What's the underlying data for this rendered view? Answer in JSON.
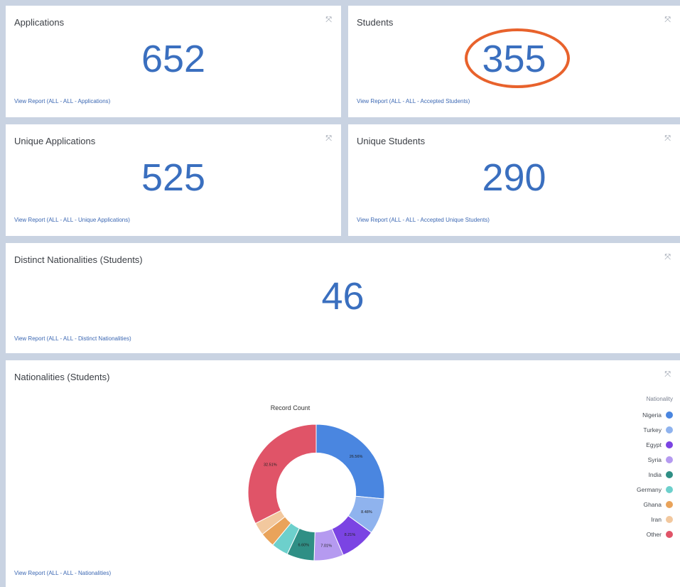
{
  "cards": {
    "applications": {
      "title": "Applications",
      "value": "652",
      "link": "View Report (ALL - ALL - Applications)"
    },
    "students": {
      "title": "Students",
      "value": "355",
      "link": "View Report (ALL - ALL - Accepted Students)"
    },
    "unique_applications": {
      "title": "Unique Applications",
      "value": "525",
      "link": "View Report (ALL - ALL - Unique Applications)"
    },
    "unique_students": {
      "title": "Unique Students",
      "value": "290",
      "link": "View Report (ALL - ALL - Accepted Unique Students)"
    },
    "distinct_nationalities": {
      "title": "Distinct Nationalities (Students)",
      "value": "46",
      "link": "View Report (ALL - ALL - Distinct Nationalities)"
    },
    "nationalities": {
      "title": "Nationalities (Students)",
      "link": "View Report (ALL - ALL - Nationalities)"
    }
  },
  "expand_icon": "⤧",
  "annotation_color": "#e8622c",
  "chart_data": {
    "type": "pie",
    "title": "Record Count",
    "legend_title": "Nationality",
    "legend_position": "right",
    "categories": [
      "Nigeria",
      "Turkey",
      "Egypt",
      "Syria",
      "India",
      "Germany",
      "Ghana",
      "Iran",
      "Other"
    ],
    "values": [
      26.5,
      8.5,
      8.5,
      7.0,
      6.5,
      4.0,
      3.5,
      3.0,
      32.5
    ],
    "slice_labels": [
      "26.56%",
      "8.48%",
      "8.21%",
      "7.01%",
      "6.60%",
      "",
      "",
      "",
      "32.51%"
    ],
    "colors": [
      "#4a86e0",
      "#8fb3ee",
      "#7b44e3",
      "#b59af0",
      "#2f8f85",
      "#6dd0cc",
      "#e9a35a",
      "#f2c89e",
      "#e05468"
    ],
    "inner_radius_ratio": 0.58
  }
}
